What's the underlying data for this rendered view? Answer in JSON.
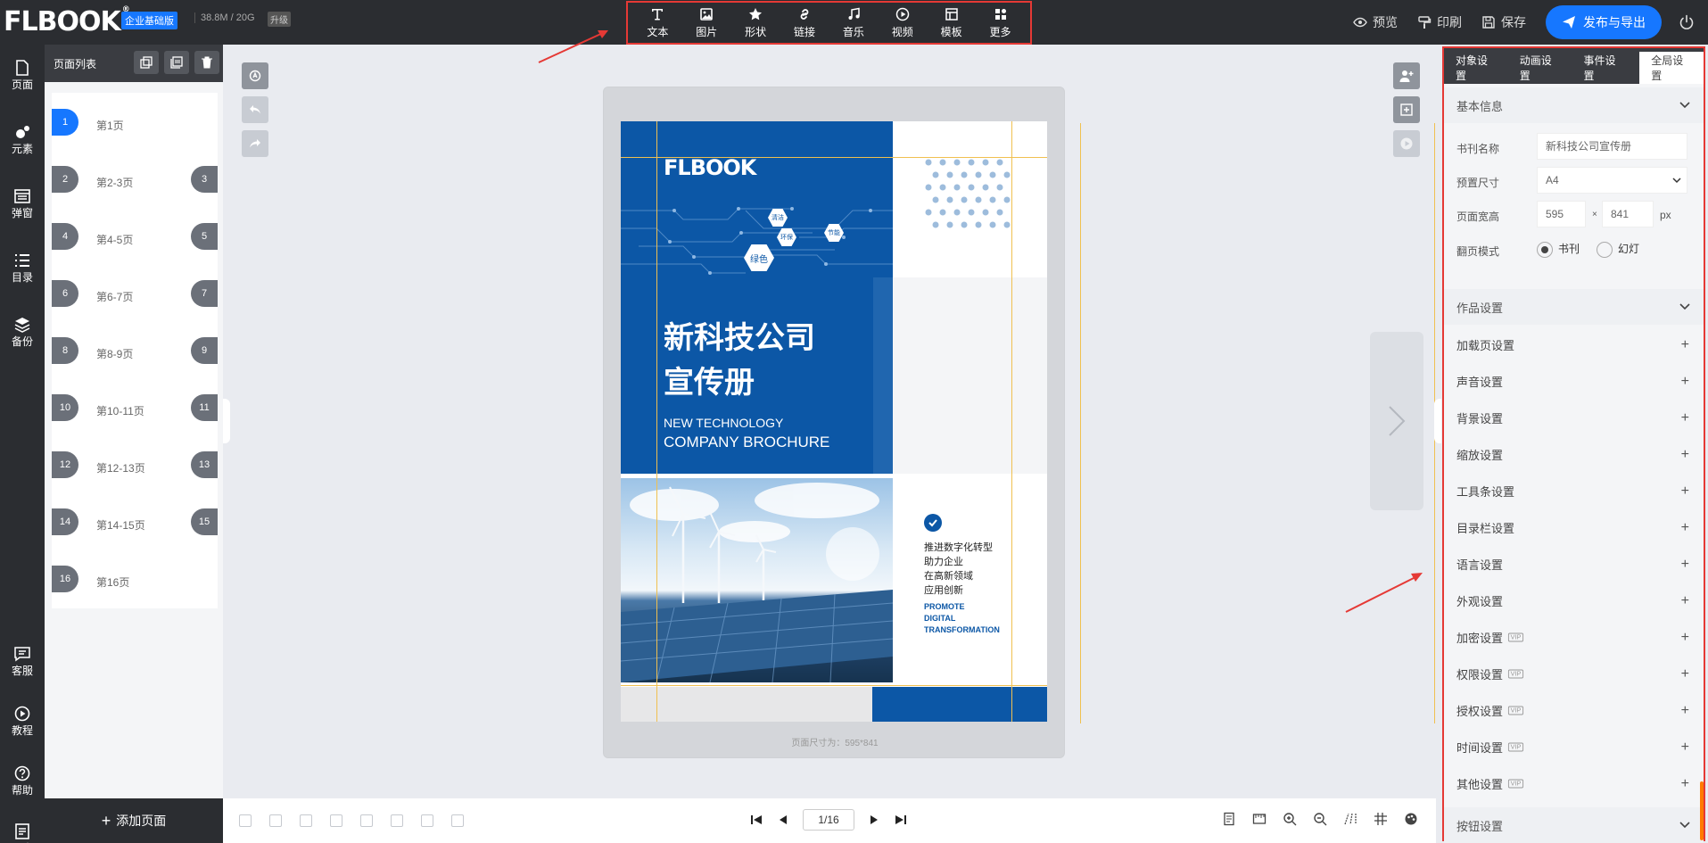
{
  "app": {
    "logo": "FLBOOK",
    "edition": "企业基础版",
    "storage": "38.8M / 20G",
    "upgrade": "升级"
  },
  "toolbar": {
    "tools": [
      {
        "label": "文本",
        "icon": "text-icon"
      },
      {
        "label": "图片",
        "icon": "image-icon"
      },
      {
        "label": "形状",
        "icon": "star-icon"
      },
      {
        "label": "链接",
        "icon": "link-icon"
      },
      {
        "label": "音乐",
        "icon": "music-icon"
      },
      {
        "label": "视频",
        "icon": "play-icon"
      },
      {
        "label": "模板",
        "icon": "template-icon"
      },
      {
        "label": "更多",
        "icon": "more-icon"
      }
    ]
  },
  "topright": {
    "preview": "预览",
    "print": "印刷",
    "save": "保存",
    "publish": "发布与导出"
  },
  "leftnav": {
    "items": [
      "页面",
      "元素",
      "弹窗",
      "目录",
      "备份"
    ],
    "bottom_items": [
      "客服",
      "教程",
      "帮助",
      "日志"
    ]
  },
  "pagelist": {
    "title": "页面列表",
    "add_page": "添加页面",
    "pages": [
      {
        "label": "第1页",
        "left": "1",
        "right": ""
      },
      {
        "label": "第2-3页",
        "left": "2",
        "right": "3"
      },
      {
        "label": "第4-5页",
        "left": "4",
        "right": "5"
      },
      {
        "label": "第6-7页",
        "left": "6",
        "right": "7"
      },
      {
        "label": "第8-9页",
        "left": "8",
        "right": "9"
      },
      {
        "label": "第10-11页",
        "left": "10",
        "right": "11"
      },
      {
        "label": "第12-13页",
        "left": "12",
        "right": "13"
      },
      {
        "label": "第14-15页",
        "left": "14",
        "right": "15"
      },
      {
        "label": "第16页",
        "left": "16",
        "right": ""
      }
    ]
  },
  "cover": {
    "logo": "FLBOOK",
    "hex1": "绿色",
    "hex2": "环保",
    "hex3": "清洁",
    "hex4": "节能",
    "title_cn_line1": "新科技公司",
    "title_cn_line2": "宣传册",
    "title_en_line1": "NEW TECHNOLOGY",
    "title_en_line2": "COMPANY BROCHURE",
    "slogan_cn": [
      "推进数字化转型",
      "助力企业",
      "在高新领域",
      "应用创新"
    ],
    "slogan_en": [
      "PROMOTE",
      "DIGITAL",
      "TRANSFORMATION"
    ]
  },
  "canvas": {
    "page_size_text": "页面尺寸为：595*841"
  },
  "pager": {
    "current": "1/16"
  },
  "rightpanel": {
    "tabs": [
      "对象设置",
      "动画设置",
      "事件设置",
      "全局设置"
    ],
    "basic_info": "基本信息",
    "name_label": "书刊名称",
    "name_value": "新科技公司宣传册",
    "size_label": "预置尺寸",
    "size_value": "A4",
    "wh_label": "页面宽高",
    "width": "595",
    "times": "×",
    "height": "841",
    "unit": "px",
    "mode_label": "翻页模式",
    "mode_book": "书刊",
    "mode_slide": "幻灯",
    "work_settings": "作品设置",
    "settings": [
      {
        "label": "加载页设置",
        "vip": false
      },
      {
        "label": "声音设置",
        "vip": false
      },
      {
        "label": "背景设置",
        "vip": false
      },
      {
        "label": "缩放设置",
        "vip": false
      },
      {
        "label": "工具条设置",
        "vip": false
      },
      {
        "label": "目录栏设置",
        "vip": false
      },
      {
        "label": "语言设置",
        "vip": false
      },
      {
        "label": "外观设置",
        "vip": false
      },
      {
        "label": "加密设置",
        "vip": true
      },
      {
        "label": "权限设置",
        "vip": true
      },
      {
        "label": "授权设置",
        "vip": true
      },
      {
        "label": "时间设置",
        "vip": true
      },
      {
        "label": "其他设置",
        "vip": true
      }
    ],
    "vip_tag": "VIP",
    "button_settings": "按钮设置"
  },
  "colors": {
    "accent": "#1677ff",
    "highlight_border": "#e53935",
    "cover_blue": "#0c57a6"
  }
}
